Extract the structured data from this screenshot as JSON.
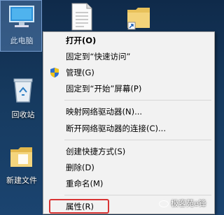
{
  "desktop": {
    "icons": [
      {
        "label": "此电脑",
        "icon": "this-pc-icon"
      },
      {
        "label": "回收站",
        "icon": "recycle-bin-icon"
      },
      {
        "label": "新建文件",
        "icon": "folder-icon"
      },
      {
        "label": "",
        "icon": "text-document-icon"
      },
      {
        "label": "",
        "icon": "folder-shortcut-icon"
      }
    ]
  },
  "context_menu": {
    "items": [
      {
        "label": "打开(O)",
        "bold": true
      },
      {
        "label": "固定到“快速访问”"
      },
      {
        "label": "管理(G)",
        "icon": "uac-shield-icon"
      },
      {
        "label": "固定到“开始”屏幕(P)"
      },
      {
        "label": "映射网络驱动器(N)..."
      },
      {
        "label": "断开网络驱动器的连接(C)..."
      },
      {
        "label": "创建快捷方式(S)"
      },
      {
        "label": "删除(D)"
      },
      {
        "label": "重命名(M)"
      },
      {
        "label": "属性(R)",
        "highlighted": true
      }
    ],
    "highlight_color": "#d93434"
  },
  "watermark": {
    "text": "极客苑e锋",
    "icon": "wechat-icon"
  }
}
